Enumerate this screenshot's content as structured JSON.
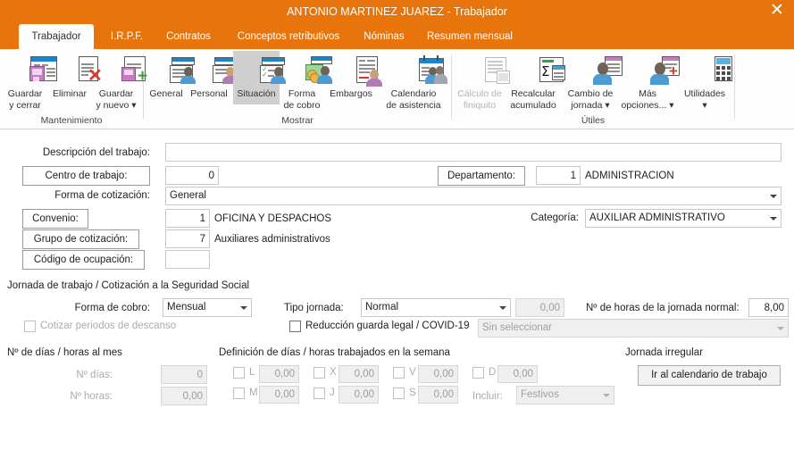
{
  "window": {
    "title": "ANTONIO MARTINEZ JUAREZ - Trabajador",
    "close_label": "✕",
    "accent_color": "#E8740C"
  },
  "tabs": [
    {
      "label": "Trabajador",
      "active": true
    },
    {
      "label": "I.R.P.F.",
      "active": false
    },
    {
      "label": "Contratos",
      "active": false
    },
    {
      "label": "Conceptos retributivos",
      "active": false
    },
    {
      "label": "Nóminas",
      "active": false
    },
    {
      "label": "Resumen mensual",
      "active": false
    }
  ],
  "ribbon": {
    "groups": [
      {
        "label": "Mantenimiento"
      },
      {
        "label": "Mostrar"
      },
      {
        "label": "Útiles"
      }
    ],
    "buttons": [
      {
        "label_line1": "Guardar",
        "label_line2": "y cerrar",
        "icon": "save-close-icon",
        "state": "normal"
      },
      {
        "label_line1": "Eliminar",
        "label_line2": "",
        "icon": "delete-icon",
        "state": "normal"
      },
      {
        "label_line1": "Guardar",
        "label_line2": "y nuevo ▾",
        "icon": "save-new-icon",
        "state": "normal"
      },
      {
        "label_line1": "General",
        "label_line2": "",
        "icon": "general-card-icon",
        "state": "normal"
      },
      {
        "label_line1": "Personal",
        "label_line2": "",
        "icon": "personal-card-icon",
        "state": "normal"
      },
      {
        "label_line1": "Situación",
        "label_line2": "",
        "icon": "situation-card-icon",
        "state": "selected"
      },
      {
        "label_line1": "Forma",
        "label_line2": "de cobro",
        "icon": "payment-form-icon",
        "state": "normal"
      },
      {
        "label_line1": "Embargos",
        "label_line2": "",
        "icon": "garnishment-icon",
        "state": "normal"
      },
      {
        "label_line1": "Calendario",
        "label_line2": "de asistencia",
        "icon": "attendance-calendar-icon",
        "state": "normal"
      },
      {
        "label_line1": "Cálculo de",
        "label_line2": "finiquito",
        "icon": "settlement-calc-icon",
        "state": "disabled"
      },
      {
        "label_line1": "Recalcular",
        "label_line2": "acumulado",
        "icon": "recalculate-icon",
        "state": "normal"
      },
      {
        "label_line1": "Cambio de",
        "label_line2": "jornada ▾",
        "icon": "workday-change-icon",
        "state": "normal"
      },
      {
        "label_line1": "Más",
        "label_line2": "opciones... ▾",
        "icon": "more-options-icon",
        "state": "normal"
      },
      {
        "label_line1": "Utilidades",
        "label_line2": "▾",
        "icon": "utilities-calculator-icon",
        "state": "normal"
      }
    ]
  },
  "form": {
    "descripcion_label": "Descripción del trabajo:",
    "descripcion_value": "",
    "centro_label": "Centro de trabajo:",
    "centro_code": "0",
    "departamento_label": "Departamento:",
    "departamento_code": "1",
    "departamento_name": "ADMINISTRACION",
    "forma_cotizacion_label": "Forma de cotización:",
    "forma_cotizacion_value": "General",
    "convenio_label": "Convenio:",
    "convenio_code": "1",
    "convenio_name": "OFICINA Y DESPACHOS",
    "categoria_label": "Categoría:",
    "categoria_value": "AUXILIAR ADMINISTRATIVO",
    "grupo_label": "Grupo de cotización:",
    "grupo_code": "7",
    "grupo_name": "Auxiliares administrativos",
    "codigo_ocupacion_label": "Código de ocupación:",
    "codigo_ocupacion_value": "",
    "jornada_section_title": "Jornada de trabajo / Cotización a la Seguridad Social",
    "forma_cobro_label": "Forma de cobro:",
    "forma_cobro_value": "Mensual",
    "tipo_jornada_label": "Tipo jornada:",
    "tipo_jornada_value": "Normal",
    "tipo_jornada_num": "0,00",
    "horas_jornada_label": "Nº de horas de la jornada normal:",
    "horas_jornada_value": "8,00",
    "cotizar_descanso_label": "Cotizar periodos de descanso",
    "reduccion_label": "Reducción guarda legal / COVID-19",
    "reduccion_select_value": "Sin seleccionar",
    "dias_mes_title": "Nº de días / horas al mes",
    "n_dias_label": "Nº días:",
    "n_dias_value": "0",
    "n_horas_label": "Nº horas:",
    "n_horas_value": "0,00",
    "semana_title": "Definición de días / horas trabajados en la semana",
    "week_days": [
      {
        "letter": "L",
        "value": "0,00"
      },
      {
        "letter": "M",
        "value": "0,00"
      },
      {
        "letter": "X",
        "value": "0,00"
      },
      {
        "letter": "J",
        "value": "0,00"
      },
      {
        "letter": "V",
        "value": "0,00"
      },
      {
        "letter": "S",
        "value": "0,00"
      },
      {
        "letter": "D",
        "value": "0,00"
      }
    ],
    "incluir_label": "Incluir:",
    "incluir_value": "Festivos",
    "jornada_irregular_title": "Jornada irregular",
    "calendario_button": "Ir al calendario de trabajo"
  }
}
